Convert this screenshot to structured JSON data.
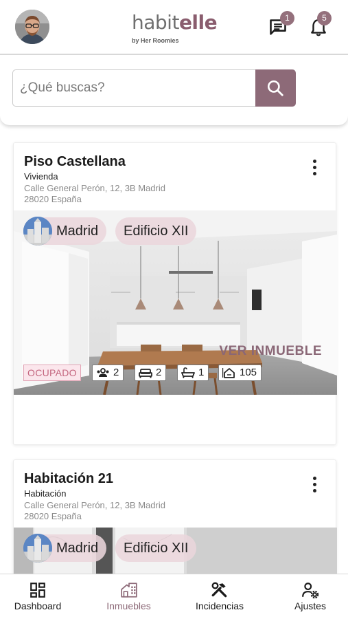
{
  "header": {
    "logo_main": "habit",
    "logo_accent": "elle",
    "logo_sub": "by Her Roomies",
    "messages_badge": "1",
    "notifications_badge": "5"
  },
  "search": {
    "placeholder": "¿Qué buscas?"
  },
  "properties": [
    {
      "title": "Piso Castellana",
      "type": "Vivienda",
      "address_line1": "Calle General Perón, 12, 3B Madrid",
      "address_line2": "28020 España",
      "location_tag": "Madrid",
      "building_tag": "Edificio XII",
      "status": "OCUPADO",
      "tenants": "2",
      "beds": "2",
      "baths": "1",
      "area": "105",
      "action": "VER INMUEBLE"
    },
    {
      "title": "Habitación 21",
      "type": "Habitación",
      "address_line1": "Calle General Perón, 12, 3B Madrid",
      "address_line2": "28020 España",
      "location_tag": "Madrid",
      "building_tag": "Edificio XII"
    }
  ],
  "nav": [
    {
      "label": "Dashboard",
      "icon": "dashboard-icon"
    },
    {
      "label": "Inmuebles",
      "icon": "building-icon",
      "active": true
    },
    {
      "label": "Incidencias",
      "icon": "tools-icon"
    },
    {
      "label": "Ajustes",
      "icon": "user-settings-icon"
    }
  ],
  "colors": {
    "accent": "#8d6a78",
    "status_text": "#c4667f",
    "status_bg": "#fbe6ec",
    "tag_bg": "#ead6dc"
  }
}
